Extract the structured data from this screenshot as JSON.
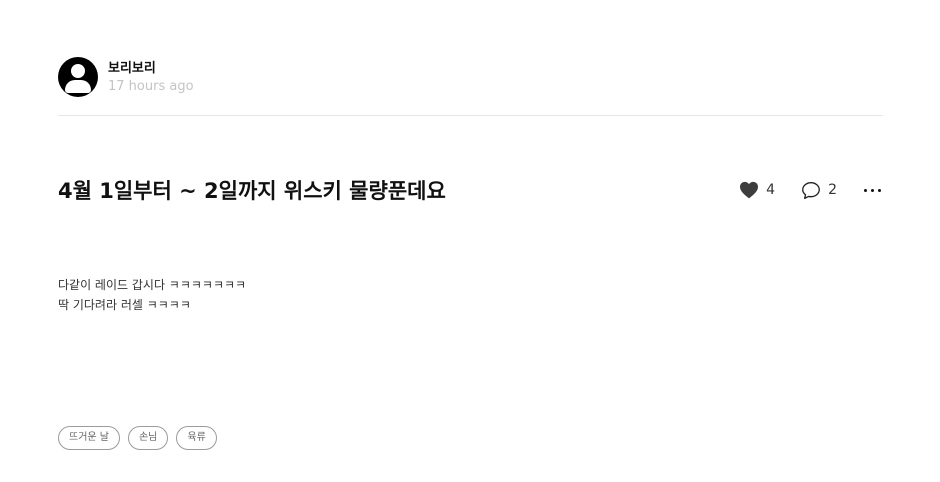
{
  "author": {
    "name": "보리보리",
    "time": "17 hours ago"
  },
  "post": {
    "title": "4월 1일부터 ~ 2일까지 위스키 물량푼데요",
    "lines": [
      "다같이 레이드 갑시다 ㅋㅋㅋㅋㅋㅋㅋ",
      "딱 기다려라 러셀 ㅋㅋㅋㅋ"
    ]
  },
  "actions": {
    "likes": "4",
    "comments": "2"
  },
  "tags": [
    "뜨거운 날",
    "손님",
    "육류"
  ],
  "icons": {
    "like": "heart-icon",
    "comment": "comment-bubble-icon",
    "more": "more-dots-icon",
    "avatar": "user-avatar-icon"
  },
  "colors": {
    "heart": "#3d3d3d",
    "meta": "#c4c4c4",
    "tag_border": "#9b9b9b"
  }
}
